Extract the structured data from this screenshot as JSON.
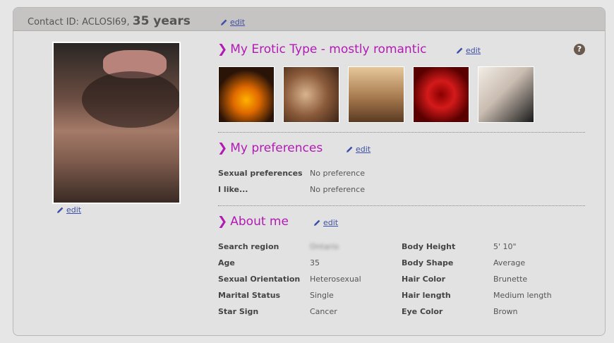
{
  "header": {
    "contact_id": "Contact ID: ACLOSI69,",
    "age_years": "35 years",
    "edit_label": "edit"
  },
  "photo": {
    "edit_label": "edit"
  },
  "erotic_type": {
    "title": "My Erotic Type - mostly romantic",
    "edit_label": "edit",
    "help": "?",
    "images": [
      "candles",
      "rose-petals-bath",
      "beach-walk",
      "red-rose",
      "lingerie"
    ]
  },
  "preferences": {
    "title": "My preferences",
    "edit_label": "edit",
    "rows": [
      {
        "label": "Sexual preferences",
        "value": "No preference"
      },
      {
        "label": "I like...",
        "value": "No preference"
      }
    ]
  },
  "about": {
    "title": "About me",
    "edit_label": "edit",
    "left": [
      {
        "label": "Search region",
        "value": "Ontario"
      },
      {
        "label": "Age",
        "value": "35"
      },
      {
        "label": "Sexual Orientation",
        "value": "Heterosexual"
      },
      {
        "label": "Marital Status",
        "value": "Single"
      },
      {
        "label": "Star Sign",
        "value": "Cancer"
      }
    ],
    "right": [
      {
        "label": "Body Height",
        "value": "5' 10\""
      },
      {
        "label": "Body Shape",
        "value": "Average"
      },
      {
        "label": "Hair Color",
        "value": "Brunette"
      },
      {
        "label": "Hair length",
        "value": "Medium length"
      },
      {
        "label": "Eye Color",
        "value": "Brown"
      }
    ]
  },
  "colors": {
    "accent": "#b21ab4",
    "link": "#3d4fa8"
  }
}
